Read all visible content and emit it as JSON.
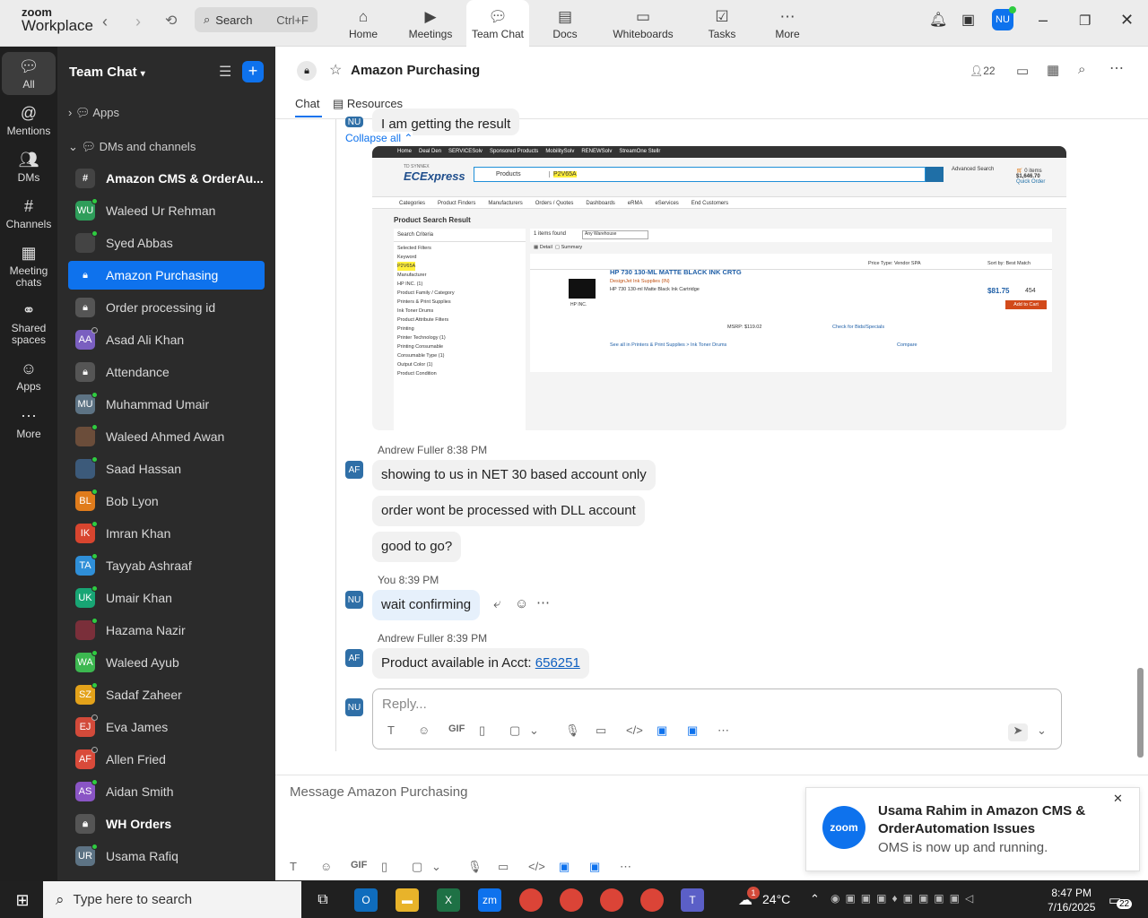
{
  "app": {
    "logo_top": "zoom",
    "logo_bottom": "Workplace",
    "search_placeholder": "Search",
    "search_shortcut": "Ctrl+F",
    "user_initials": "NU"
  },
  "tabs": [
    {
      "label": "Home",
      "icon": "home-icon"
    },
    {
      "label": "Meetings",
      "icon": "video-camera-icon"
    },
    {
      "label": "Team Chat",
      "icon": "chat-bubble-icon",
      "active": true
    },
    {
      "label": "Docs",
      "icon": "document-icon"
    },
    {
      "label": "Whiteboards",
      "icon": "whiteboard-icon"
    },
    {
      "label": "Tasks",
      "icon": "tasks-icon"
    },
    {
      "label": "More",
      "icon": "more-dots-icon"
    }
  ],
  "rail": [
    {
      "label": "All",
      "icon": "chat-bubble-icon",
      "active": true
    },
    {
      "label": "Mentions",
      "icon": "at-icon"
    },
    {
      "label": "DMs",
      "icon": "people-icon"
    },
    {
      "label": "Channels",
      "icon": "hash-icon"
    },
    {
      "label": "Meeting chats",
      "icon": "calendar-icon"
    },
    {
      "label": "Shared spaces",
      "icon": "shared-icon"
    },
    {
      "label": "Apps",
      "icon": "apps-icon"
    },
    {
      "label": "More",
      "icon": "more-dots-icon"
    }
  ],
  "sidebar": {
    "title": "Team Chat",
    "apps_label": "Apps",
    "dms_label": "DMs and channels",
    "items": [
      {
        "label": "Amazon CMS & OrderAu...",
        "type": "hash",
        "bold": true
      },
      {
        "label": "Waleed Ur Rehman",
        "initials": "WU",
        "color": "#2e9d5a",
        "status": "on"
      },
      {
        "label": "Syed Abbas",
        "initials": "",
        "color": "#444",
        "status": "on"
      },
      {
        "label": "Amazon Purchasing",
        "type": "lock",
        "active": true
      },
      {
        "label": "Order processing id",
        "type": "lock"
      },
      {
        "label": "Asad Ali Khan",
        "initials": "AA",
        "color": "#7a5fc0",
        "status": "off"
      },
      {
        "label": "Attendance",
        "type": "lock"
      },
      {
        "label": "Muhammad Umair",
        "initials": "MU",
        "color": "#5d7384",
        "status": "on"
      },
      {
        "label": "Waleed Ahmed Awan",
        "initials": "",
        "color": "#6b4d3a",
        "status": "on"
      },
      {
        "label": "Saad Hassan",
        "initials": "",
        "color": "#3c5a7a",
        "status": "on"
      },
      {
        "label": "Bob Lyon",
        "initials": "BL",
        "color": "#e07c1c",
        "status": "on"
      },
      {
        "label": "Imran Khan",
        "initials": "IK",
        "color": "#d8452f",
        "status": "on"
      },
      {
        "label": "Tayyab Ashraaf",
        "initials": "TA",
        "color": "#2f8fd8",
        "status": "on"
      },
      {
        "label": "Umair Khan",
        "initials": "UK",
        "color": "#18a574",
        "status": "on"
      },
      {
        "label": "Hazama Nazir",
        "initials": "",
        "color": "#7a2f3a",
        "status": "on"
      },
      {
        "label": "Waleed Ayub",
        "initials": "WA",
        "color": "#3cb850",
        "status": "on"
      },
      {
        "label": "Sadaf Zaheer",
        "initials": "SZ",
        "color": "#e3a21a",
        "status": "on"
      },
      {
        "label": "Eva James",
        "initials": "EJ",
        "color": "#d24a3a",
        "status": "off"
      },
      {
        "label": "Allen Fried",
        "initials": "AF",
        "color": "#d94a3a",
        "status": "off"
      },
      {
        "label": "Aidan Smith",
        "initials": "AS",
        "color": "#8a55c5",
        "status": "on"
      },
      {
        "label": "WH Orders",
        "type": "lock",
        "bold": true
      },
      {
        "label": "Usama Rafiq",
        "initials": "UR",
        "color": "#5d7384",
        "status": "on"
      }
    ]
  },
  "channel": {
    "title": "Amazon Purchasing",
    "members": "22",
    "tab_chat": "Chat",
    "tab_resources": "Resources"
  },
  "chat": {
    "partial_msg": "I am getting the result",
    "collapse": "Collapse all",
    "shot": {
      "nav": [
        "Home",
        "Deal Den",
        "SERVICESolv",
        "Sponsored Products",
        "MobilitySolv",
        "RENEWSolv",
        "StreamOne Stellr"
      ],
      "brand_top": "TD SYNNEX",
      "brand": "ECExpress",
      "search_select": "Products",
      "search_value": "P2V65A",
      "adv": "Advanced Search",
      "cart": "0 items",
      "cart_total": "$1,646.70",
      "quick": "Quick Order",
      "menu": [
        "Categories",
        "Product Finders",
        "Manufacturers",
        "Orders / Quotes",
        "Dashboards",
        "eRMA",
        "eServices",
        "End Customers"
      ],
      "psr": "Product Search Result",
      "criteria": "Search Criteria",
      "found": "1 items found",
      "warehouse": "Any Warehouse",
      "filters": [
        "Selected Filters",
        "Keyword",
        "Manufacturer",
        "HP INC. (1)",
        "Product Family / Category",
        "Printers & Print Supplies",
        "Ink Toner Drums",
        "Product Attribute Filters",
        "Printing",
        "Printer Technology (1)",
        "Printing Consumable",
        "Consumable Type (1)",
        "Output Color (1)",
        "Product Condition"
      ],
      "detail": "Detail",
      "summary": "Summary",
      "price_type": "Price Type: Vendor SPA",
      "sort": "Sort by: Best Match",
      "product": "HP 730 130-ML MATTE BLACK INK CRTG",
      "designjet": "DesignJet Ink Supplies (IN)",
      "desc": "HP 730 130-ml Matte Black Ink Cartridge",
      "price": "$81.75",
      "qty": "454",
      "add": "Add to Cart",
      "hp": "HP INC.",
      "msrp": "MSRP: $119.02",
      "check": "Check for Bids/Specials",
      "compare": "Compare",
      "see": "See all in Printers & Print Supplies > Ink Toner Drums"
    },
    "msgs": [
      {
        "sender": "Andrew Fuller",
        "time": "8:38 PM",
        "initials": "AF",
        "lines": [
          "showing to us in NET 30 based account only",
          "order wont be processed with DLL account",
          "good to go?"
        ]
      },
      {
        "sender": "You",
        "time": "8:39 PM",
        "initials": "NU",
        "lines": [
          "wait confirming"
        ]
      },
      {
        "sender": "Andrew Fuller",
        "time": "8:39 PM",
        "initials": "AF",
        "text": "Product available in Acct: ",
        "link": "656251"
      }
    ],
    "reply_placeholder": "Reply...",
    "compose_placeholder": "Message Amazon Purchasing",
    "gif": "GIF"
  },
  "toast": {
    "title": "Usama Rahim in Amazon CMS & OrderAutomation Issues",
    "body": "OMS is now up and running.",
    "logo": "zoom"
  },
  "taskbar": {
    "search": "Type here to search",
    "temp": "24°C",
    "time": "8:47 PM",
    "date": "7/16/2025",
    "badge": "22",
    "weather_badge": "1"
  },
  "colors": {
    "accent": "#0e72ed",
    "sidebar_bg": "#2b2b2b",
    "rail_bg": "#1f1f1f"
  }
}
